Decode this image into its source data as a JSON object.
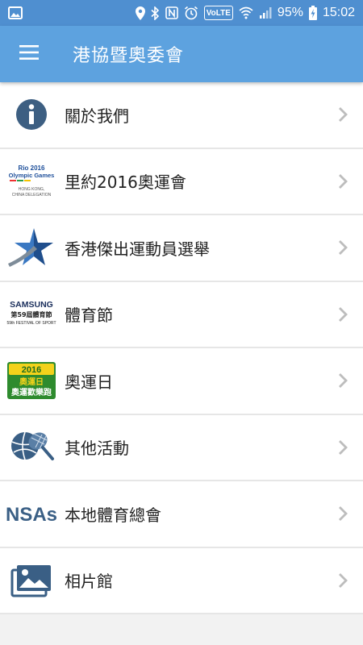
{
  "statusbar": {
    "network": "VoLTE",
    "battery": "95%",
    "time": "15:02",
    "icons": [
      "image-icon",
      "location-icon",
      "bluetooth-icon",
      "nfc-icon",
      "alarm-icon",
      "wifi-icon",
      "signal-icon",
      "battery-charging-icon"
    ]
  },
  "appbar": {
    "title": "港協暨奧委會",
    "menu_icon": "hamburger-menu-icon"
  },
  "colors": {
    "statusbar": "#4f8fd0",
    "appbar": "#5da2df",
    "background": "#f2f2f2",
    "chevron": "#bdbdbd"
  },
  "items": [
    {
      "label": "關於我們",
      "icon": "info-icon"
    },
    {
      "label": "里約2016奧運會",
      "icon": "rio-2016-logo",
      "logo_text": [
        "Rio 2016",
        "Olympic Games",
        "HONG KONG,",
        "CHINA DELEGATION"
      ]
    },
    {
      "label": "香港傑出運動員選舉",
      "icon": "star-athlete-logo"
    },
    {
      "label": "體育節",
      "icon": "samsung-festival-logo",
      "logo_text": [
        "SAMSUNG",
        "第59屆體育節",
        "59th FESTIVAL OF SPORT"
      ]
    },
    {
      "label": "奧運日",
      "icon": "olympic-day-logo",
      "logo_text": [
        "2016",
        "奧運日",
        "奧運歡樂跑"
      ]
    },
    {
      "label": "其他活動",
      "icon": "sports-activities-icon"
    },
    {
      "label": "本地體育總會",
      "icon": "nsas-logo",
      "logo_text": [
        "NSAs"
      ]
    },
    {
      "label": "相片館",
      "icon": "photo-gallery-icon"
    }
  ]
}
